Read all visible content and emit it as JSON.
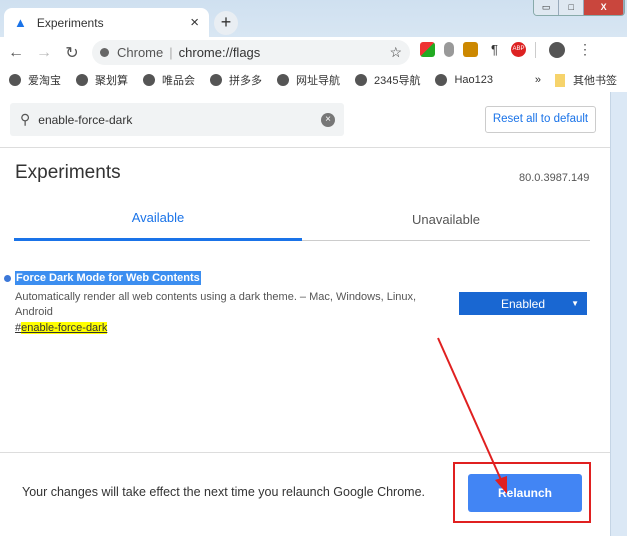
{
  "browser": {
    "tab_title": "Experiments",
    "new_tab": "+",
    "close": "×",
    "window_buttons": [
      "▭",
      "□",
      "X"
    ],
    "omnibox": {
      "site": "Chrome",
      "url": "chrome://flags"
    },
    "extensions": [
      "ABP"
    ],
    "bookmarks": [
      "爱淘宝",
      "聚划算",
      "唯品会",
      "拼多多",
      "网址导航",
      "2345导航",
      "Hao123"
    ],
    "more_bookmarks": "»",
    "other_bookmarks": "其他书签"
  },
  "page": {
    "search": {
      "value": "enable-force-dark"
    },
    "reset_label": "Reset all to default",
    "title": "Experiments",
    "version": "80.0.3987.149",
    "tabs": [
      {
        "label": "Available",
        "active": true
      },
      {
        "label": "Unavailable",
        "active": false
      }
    ],
    "flag": {
      "name": "Force Dark Mode for Web Contents",
      "description": "Automatically render all web contents using a dark theme. – Mac, Windows, Linux, Android",
      "hash_prefix": "#",
      "hash": "enable-force-dark",
      "value": "Enabled"
    },
    "footer": {
      "message": "Your changes will take effect the next time you relaunch Google Chrome.",
      "relaunch_label": "Relaunch"
    }
  },
  "colors": {
    "accent": "#1a73e8",
    "annotation": "#e02020",
    "highlight": "#ffff00"
  }
}
